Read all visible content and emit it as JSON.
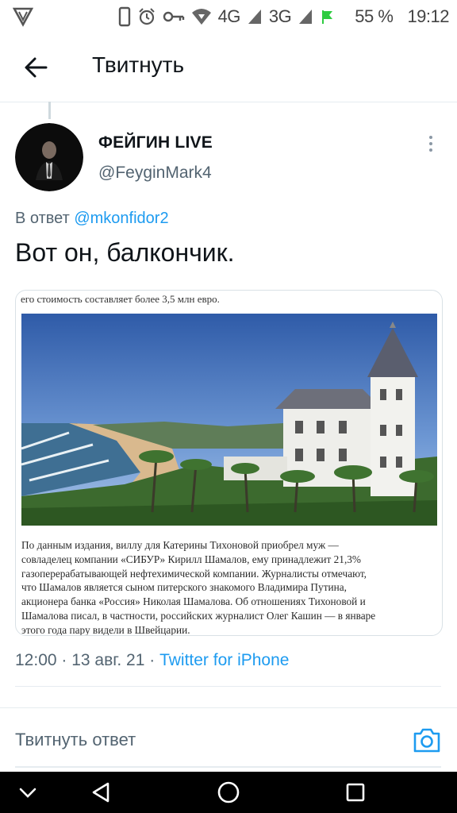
{
  "status_bar": {
    "network_4g": "4G",
    "network_3g": "3G",
    "battery": "55 %",
    "time": "19:12",
    "icons": [
      "vpn-icon",
      "phone-icon",
      "alarm-icon",
      "key-icon",
      "wifi-icon",
      "signal-icon",
      "flag-icon"
    ]
  },
  "header": {
    "title": "Твитнуть"
  },
  "tweet": {
    "author_name": "ФЕЙГИН LIVE",
    "author_handle": "@FeyginMark4",
    "reply_prefix": "В ответ",
    "reply_to": "@mkonfidor2",
    "text": "Вот он, балкончик.",
    "media": {
      "top_caption": "его стоимость составляет более 3,5 млн евро.",
      "article_lines": [
        "По данным издания, виллу для Катерины Тихоновой приобрел муж —",
        "совладелец компании «СИБУР» Кирилл Шамалов, ему принадлежит 21,3%",
        "газоперерабатывающей нефтехимической компании. Журналисты отмечают,",
        "что Шамалов является сыном питерского знакомого Владимира Путина,",
        "акционера банка «Россия» Николая Шамалова. Об отношениях Тихоновой и",
        "Шамалова писал, в частности, российских журналист Олег Кашин — в январе",
        "этого года пару видели в Швейцарии."
      ]
    },
    "time": "12:00",
    "sep1": " · ",
    "date": "13 авг. 21",
    "sep2": " · ",
    "source": "Twitter for iPhone"
  },
  "reply_box": {
    "placeholder": "Твитнуть ответ"
  },
  "colors": {
    "accent": "#1d9bf0",
    "secondary_text": "#536471",
    "primary_text": "#0f1419"
  }
}
